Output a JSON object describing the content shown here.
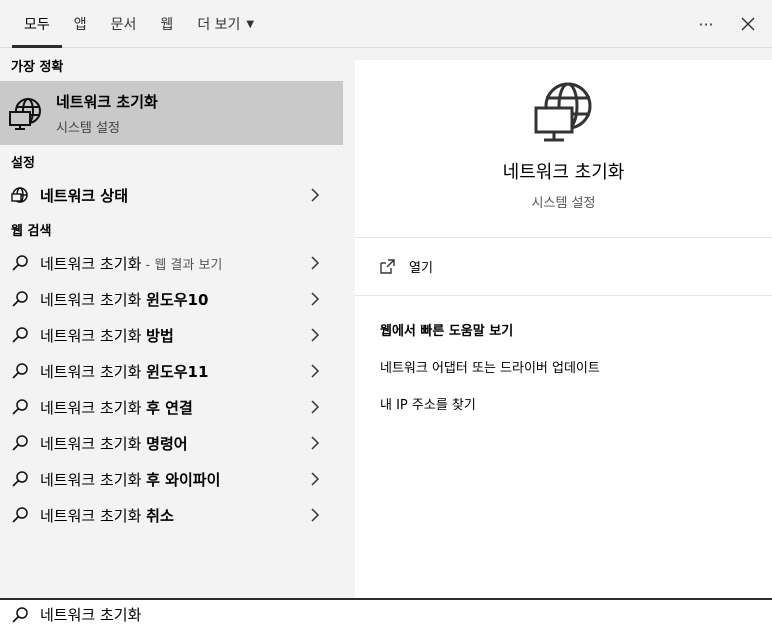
{
  "tabs": [
    {
      "label": "모두",
      "active": true
    },
    {
      "label": "앱"
    },
    {
      "label": "문서"
    },
    {
      "label": "웹"
    },
    {
      "label": "더 보기"
    }
  ],
  "top_actions": {
    "more_icon": "ellipsis-icon",
    "close_icon": "close-icon"
  },
  "left": {
    "best_match_title": "가장 정확",
    "best_match": {
      "title": "네트워크 초기화",
      "subtitle": "시스템 설정",
      "icon": "globe-monitor-icon"
    },
    "settings_title": "설정",
    "settings_items": [
      {
        "label": "네트워크 상태",
        "icon": "globe-icon"
      }
    ],
    "web_title": "웹 검색",
    "web_items": [
      {
        "prefix": "네트워크 초기화",
        "bold": "",
        "muted": " - 웹 결과 보기"
      },
      {
        "prefix": "네트워크 초기화 ",
        "bold": "윈도우10",
        "muted": ""
      },
      {
        "prefix": "네트워크 초기화 ",
        "bold": "방법",
        "muted": ""
      },
      {
        "prefix": "네트워크 초기화 ",
        "bold": "윈도우11",
        "muted": ""
      },
      {
        "prefix": "네트워크 초기화 ",
        "bold": "후 연결",
        "muted": ""
      },
      {
        "prefix": "네트워크 초기화 ",
        "bold": "명령어",
        "muted": ""
      },
      {
        "prefix": "네트워크 초기화 ",
        "bold": "후 와이파이",
        "muted": ""
      },
      {
        "prefix": "네트워크 초기화 ",
        "bold": "취소",
        "muted": ""
      }
    ]
  },
  "right": {
    "title": "네트워크 초기화",
    "subtitle": "시스템 설정",
    "open_label": "열기",
    "web_help_title": "웹에서 빠른 도움말 보기",
    "web_help_links": [
      "네트워크 어댑터 또는 드라이버 업데이트",
      "내 IP 주소를 찾기"
    ]
  },
  "search": {
    "value": "네트워크 초기화"
  }
}
